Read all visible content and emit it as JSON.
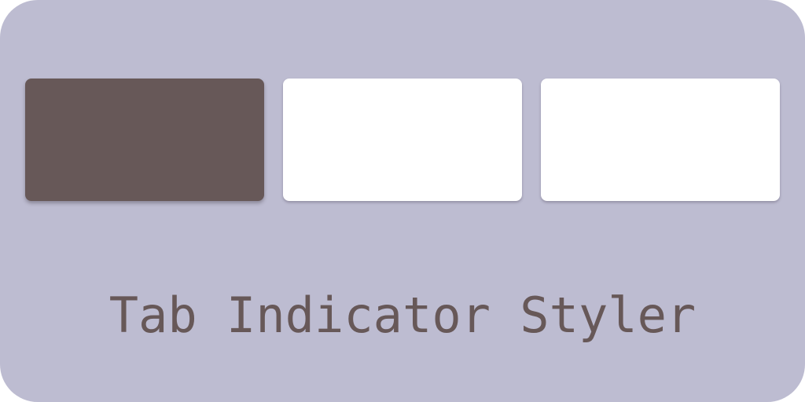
{
  "app": {
    "title": "Tab Indicator Styler"
  },
  "tabs": [
    {
      "state": "selected",
      "color": "#675858"
    },
    {
      "state": "unselected",
      "color": "#ffffff"
    },
    {
      "state": "unselected",
      "color": "#ffffff"
    }
  ],
  "colors": {
    "background": "#bdbcd1",
    "accent": "#675858",
    "tab_surface": "#ffffff"
  }
}
